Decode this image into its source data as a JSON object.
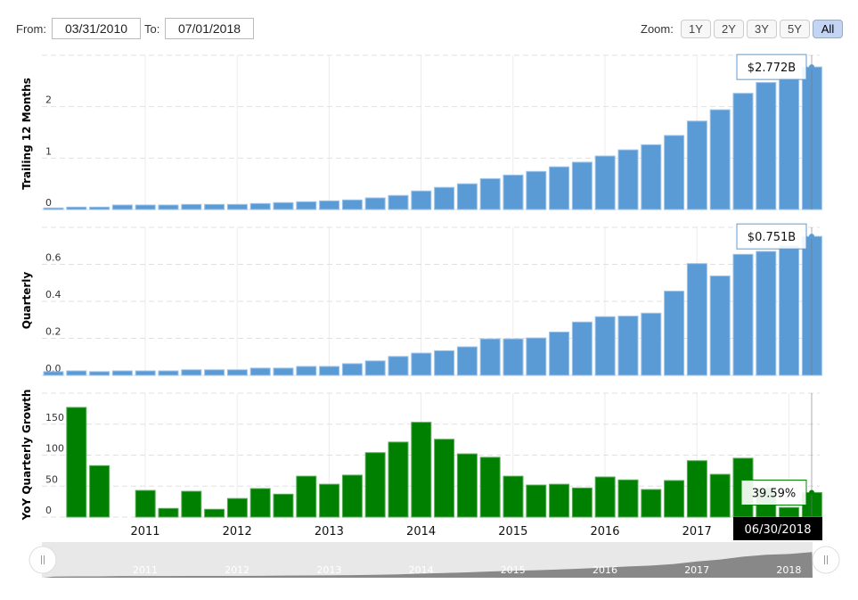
{
  "controls": {
    "from_label": "From:",
    "from_value": "03/31/2010",
    "to_label": "To:",
    "to_value": "07/01/2018",
    "zoom_label": "Zoom:",
    "zoom_buttons": [
      "1Y",
      "2Y",
      "3Y",
      "5Y",
      "All"
    ],
    "zoom_selected": "All"
  },
  "colors": {
    "revenue_bar": "#5b9bd5",
    "growth_bar": "#008000",
    "navigator_fill": "#888888"
  },
  "chart_data": [
    {
      "type": "bar",
      "ylabel": "Trailing 12 Months",
      "yticks": [
        "0",
        "1",
        "2"
      ],
      "ylim": [
        0,
        3
      ],
      "grid": true,
      "tooltip": "$2.772B",
      "categories": [
        "03/31/2010",
        "06/30/2010",
        "09/30/2010",
        "12/31/2010",
        "03/31/2011",
        "06/30/2011",
        "09/30/2011",
        "12/31/2011",
        "03/31/2012",
        "06/30/2012",
        "09/30/2012",
        "12/31/2012",
        "03/31/2013",
        "06/30/2013",
        "09/30/2013",
        "12/31/2013",
        "03/31/2014",
        "06/30/2014",
        "09/30/2014",
        "12/31/2014",
        "03/31/2015",
        "06/30/2015",
        "09/30/2015",
        "12/31/2015",
        "03/31/2016",
        "06/30/2016",
        "09/30/2016",
        "12/31/2016",
        "03/31/2017",
        "06/30/2017",
        "09/30/2017",
        "12/31/2017",
        "03/31/2018",
        "06/30/2018"
      ],
      "values": [
        0.03,
        0.047,
        0.047,
        0.087,
        0.087,
        0.087,
        0.099,
        0.099,
        0.099,
        0.116,
        0.134,
        0.151,
        0.168,
        0.186,
        0.226,
        0.273,
        0.36,
        0.43,
        0.5,
        0.6,
        0.67,
        0.74,
        0.83,
        0.92,
        1.04,
        1.16,
        1.26,
        1.44,
        1.72,
        1.94,
        2.26,
        2.47,
        2.56,
        2.772
      ]
    },
    {
      "type": "bar",
      "ylabel": "Quarterly",
      "yticks": [
        "0.0",
        "0.2",
        "0.4",
        "0.6"
      ],
      "ylim": [
        0,
        0.8
      ],
      "grid": true,
      "tooltip": "$0.751B",
      "values": [
        0.02,
        0.024,
        0.02,
        0.024,
        0.024,
        0.024,
        0.03,
        0.03,
        0.03,
        0.039,
        0.039,
        0.048,
        0.048,
        0.063,
        0.078,
        0.102,
        0.12,
        0.133,
        0.154,
        0.197,
        0.197,
        0.202,
        0.234,
        0.288,
        0.317,
        0.32,
        0.336,
        0.455,
        0.604,
        0.537,
        0.654,
        0.67,
        0.7,
        0.751
      ]
    },
    {
      "type": "bar",
      "ylabel": "YoY Quarterly Growth",
      "yticks": [
        "0",
        "50",
        "100",
        "150"
      ],
      "ylim": [
        0,
        200
      ],
      "grid": true,
      "tooltip": "39.59%",
      "values": [
        null,
        177,
        83,
        null,
        43,
        14,
        41.6,
        12.6,
        30,
        46,
        37,
        66,
        53,
        67.7,
        104,
        121,
        153,
        125.6,
        102,
        96.5,
        66,
        51.7,
        53,
        47,
        64.7,
        60,
        44.5,
        59,
        91,
        69,
        95,
        47,
        15.5,
        39.59
      ]
    }
  ],
  "xaxis": {
    "ticks": [
      "2011",
      "2012",
      "2013",
      "2014",
      "2015",
      "2016",
      "2017",
      "2018"
    ],
    "crosshair_label": "06/30/2018"
  },
  "navigator": {
    "ticks": [
      "2011",
      "2012",
      "2013",
      "2014",
      "2015",
      "2016",
      "2017",
      "2018"
    ]
  }
}
